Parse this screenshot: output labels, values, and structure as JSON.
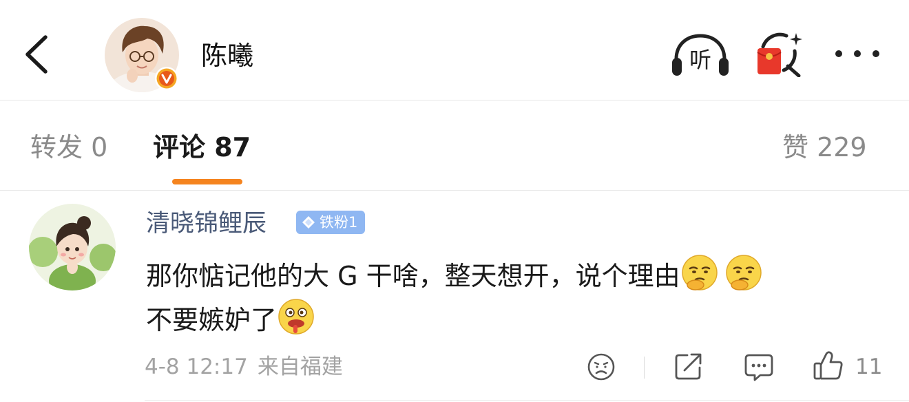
{
  "header": {
    "username": "陈曦",
    "listen_label": "听",
    "icons": [
      "back-icon",
      "verified-badge-icon",
      "listen-icon",
      "red-envelope-search-icon",
      "more-icon"
    ]
  },
  "tabs": {
    "repost": "转发 0",
    "comments": "评论 87",
    "likes": "赞 229",
    "active": "comments",
    "accent_color": "#f5841f"
  },
  "comment": {
    "author": "清晓锦鲤辰",
    "fan_badge": "铁粉1",
    "line1": "那你惦记他的大 G 干啥，整天想开，说个理由",
    "line2": "不要嫉妒了",
    "line1_emojis": [
      "thinking-emoji",
      "thinking-emoji"
    ],
    "line2_emojis": [
      "drooling-emoji"
    ],
    "time": "4-8 12:17",
    "location": "来自福建",
    "like_count": "11",
    "name_color": "#4a5a78",
    "badge_color": "#8fb7f2"
  }
}
